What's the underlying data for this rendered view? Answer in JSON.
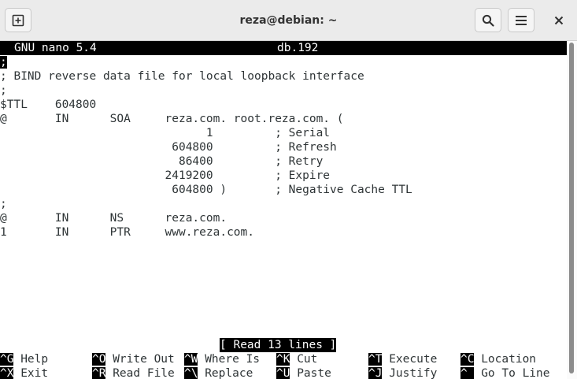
{
  "window": {
    "title": "reza@debian: ~",
    "new_tab_icon": "new-tab-icon",
    "search_icon": "search-icon",
    "menu_icon": "hamburger-menu-icon",
    "close_icon": "close-icon"
  },
  "nano": {
    "program": "GNU nano 5.4",
    "filename": "db.192",
    "lines": [
      ";",
      "; BIND reverse data file for local loopback interface",
      ";",
      "$TTL    604800",
      "@       IN      SOA     reza.com. root.reza.com. (",
      "                              1         ; Serial",
      "                         604800         ; Refresh",
      "                          86400         ; Retry",
      "                        2419200         ; Expire",
      "                         604800 )       ; Negative Cache TTL",
      ";",
      "@       IN      NS      reza.com.",
      "1       IN      PTR     www.reza.com."
    ],
    "status": "[ Read 13 lines ]",
    "shortcuts": {
      "row1": [
        {
          "key": "^G",
          "label": " Help"
        },
        {
          "key": "^O",
          "label": " Write Out"
        },
        {
          "key": "^W",
          "label": " Where Is"
        },
        {
          "key": "^K",
          "label": " Cut"
        },
        {
          "key": "^T",
          "label": " Execute"
        },
        {
          "key": "^C",
          "label": " Location"
        }
      ],
      "row2": [
        {
          "key": "^X",
          "label": " Exit"
        },
        {
          "key": "^R",
          "label": " Read File"
        },
        {
          "key": "^\\",
          "label": " Replace"
        },
        {
          "key": "^U",
          "label": " Paste"
        },
        {
          "key": "^J",
          "label": " Justify"
        },
        {
          "key": "^_",
          "label": " Go To Line"
        }
      ]
    }
  },
  "colors": {
    "titlebar_bg": "#ebebeb",
    "terminal_bg": "#ffffff",
    "text": "#2e3436",
    "inverse_bg": "#000000",
    "inverse_fg": "#ffffff"
  }
}
